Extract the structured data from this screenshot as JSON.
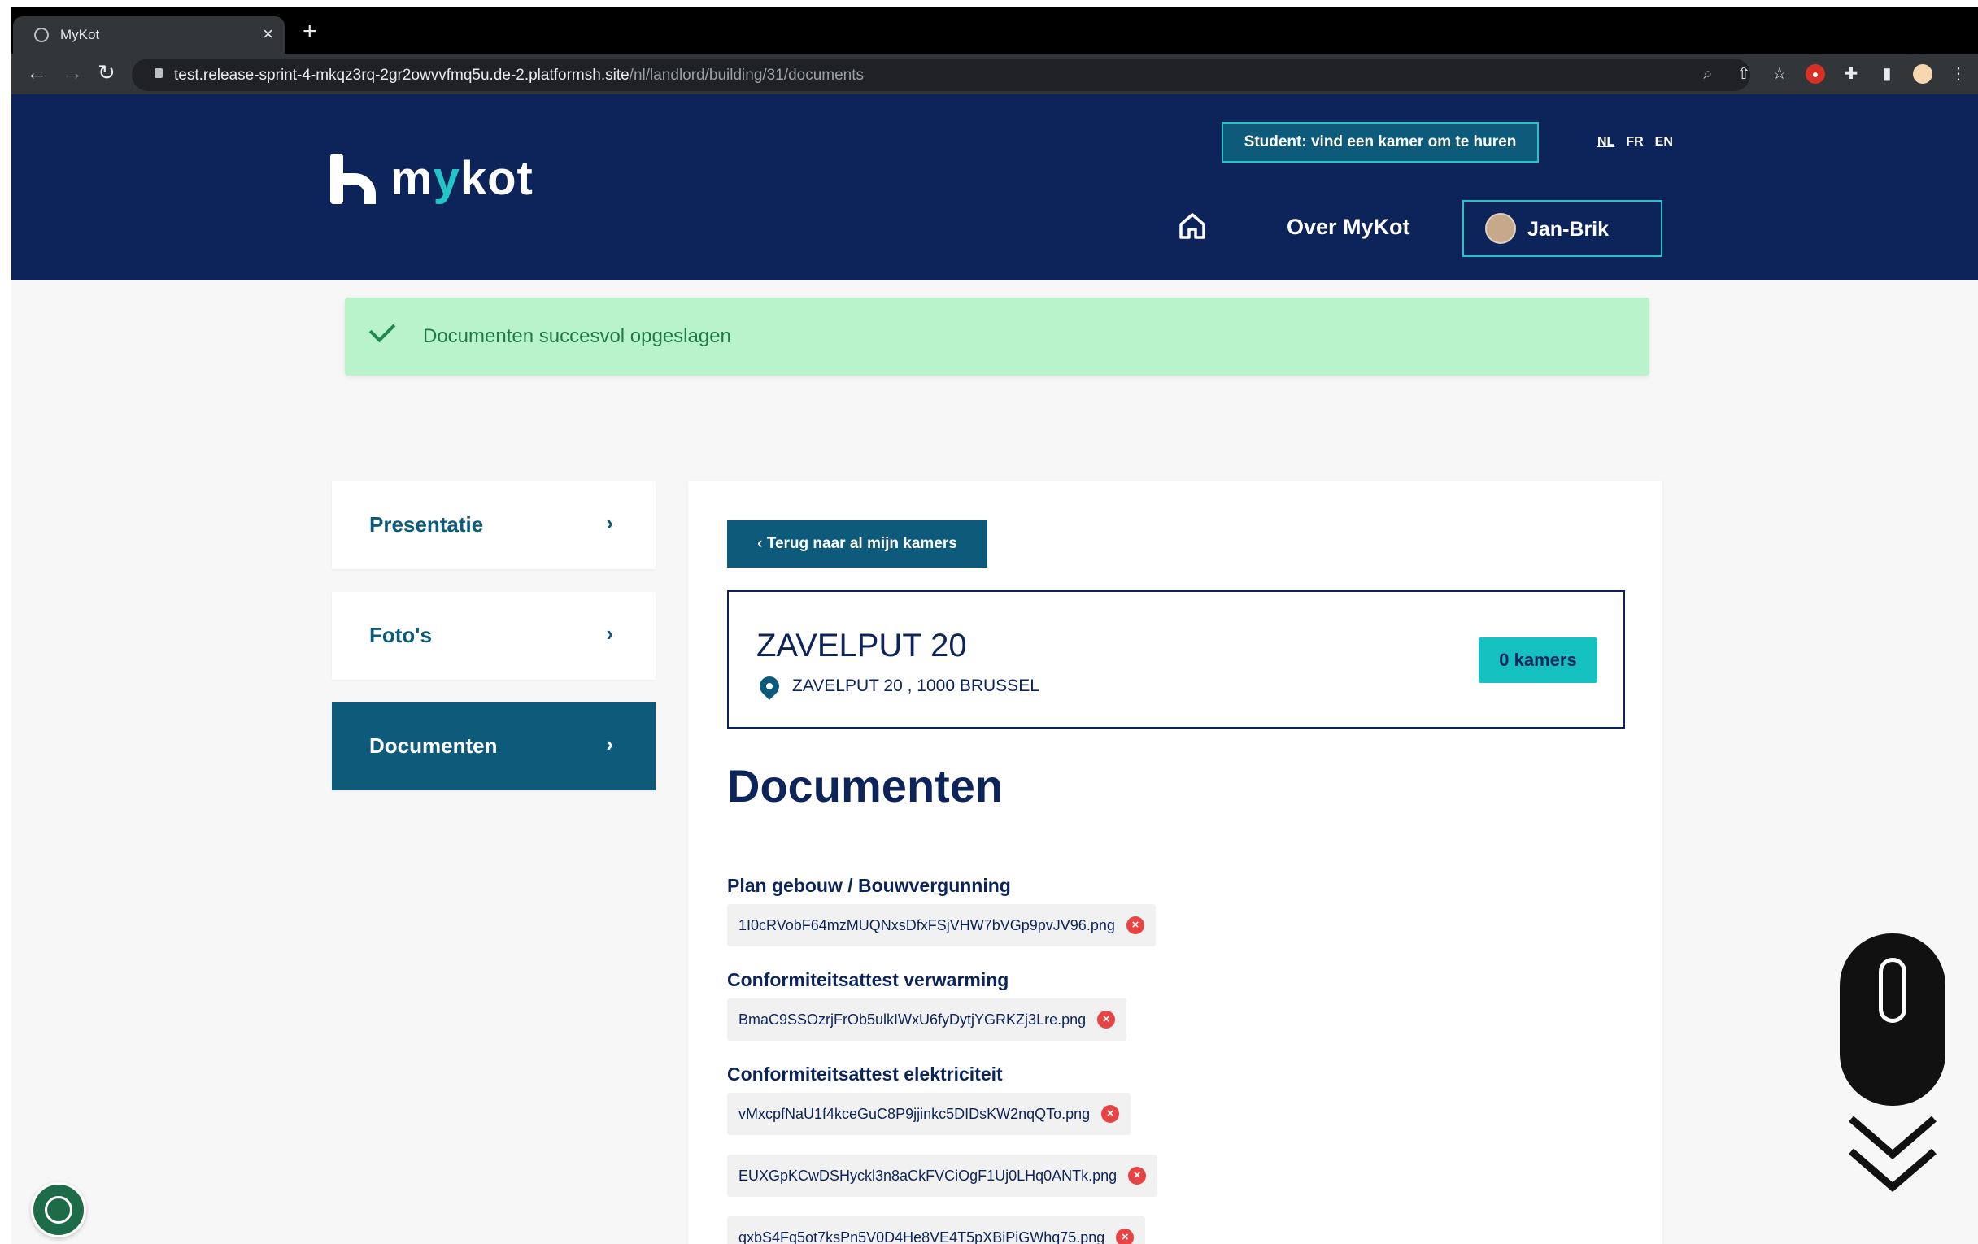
{
  "browser": {
    "tab_title": "MyKot",
    "url_host": "test.release-sprint-4-mkqz3rq-2gr2owvvfmq5u.de-2.platformsh.site",
    "url_path": "/nl/landlord/building/31/documents"
  },
  "header": {
    "logo_text_pre": "m",
    "logo_text_y": "y",
    "logo_text_post": "kot",
    "student_button": "Student: vind een kamer om te huren",
    "languages": [
      "NL",
      "FR",
      "EN"
    ],
    "about_link": "Over MyKot",
    "user_name": "Jan-Brik"
  },
  "alert": {
    "message": "Documenten succesvol opgeslagen"
  },
  "sidebar": {
    "items": [
      {
        "label": "Presentatie",
        "active": false
      },
      {
        "label": "Foto's",
        "active": false
      },
      {
        "label": "Documenten",
        "active": true
      }
    ]
  },
  "main": {
    "back_button": "Terug naar al mijn kamers",
    "building_name": "ZAVELPUT 20",
    "building_address": "ZAVELPUT 20 , 1000 BRUSSEL",
    "rooms_badge": "0 kamers",
    "title": "Documenten",
    "sections": [
      {
        "label": "Plan gebouw / Bouwvergunning",
        "files": [
          "1I0cRVobF64mzMUQNxsDfxFSjVHW7bVGp9pvJV96.png"
        ]
      },
      {
        "label": "Conformiteitsattest verwarming",
        "files": [
          "BmaC9SSOzrjFrOb5ulkIWxU6fyDytjYGRKZj3Lre.png"
        ]
      },
      {
        "label": "Conformiteitsattest elektriciteit",
        "files": [
          "vMxcpfNaU1f4kceGuC8P9jjinkc5DIDsKW2nqQTo.png",
          "EUXGpKCwDSHyckl3n8aCkFVCiOgF1Uj0LHq0ANTk.png",
          "qxbS4Fq5ot7ksPn5V0D4He8VE4T5pXBiPiGWhq75.png"
        ]
      }
    ]
  },
  "colors": {
    "navy": "#0c2459",
    "teal": "#0e5a7a",
    "cyan": "#14c0c0",
    "success_bg": "#b9f3cb",
    "danger": "#e84444"
  }
}
